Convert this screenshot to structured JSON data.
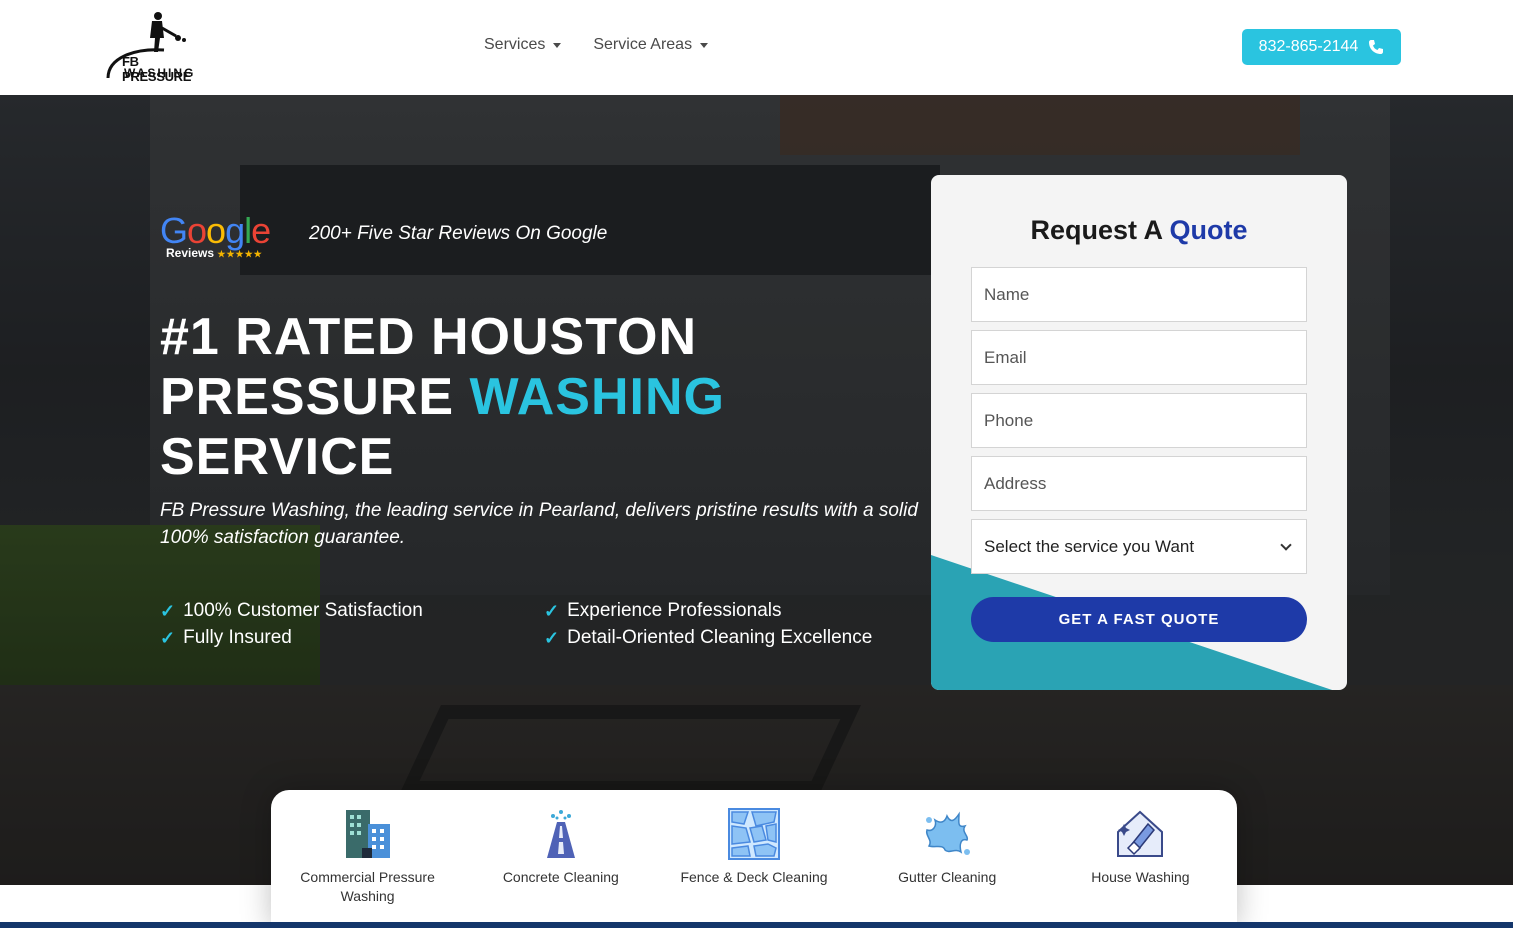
{
  "brand": {
    "line1": "FB PRESSURE",
    "line2": "WASHING"
  },
  "nav": {
    "items": [
      {
        "label": "Services"
      },
      {
        "label": "Service Areas"
      }
    ]
  },
  "header": {
    "phone": "832-865-2144"
  },
  "hero": {
    "google_word": "Google",
    "google_sub": "Reviews",
    "google_stars": "★★★★★",
    "review_text": "200+ Five Star Reviews On Google",
    "headline_line1": "#1 RATED HOUSTON",
    "headline_line2_pre": "PRESSURE ",
    "headline_line2_accent": "WASHING",
    "headline_line3": "SERVICE",
    "subcopy": "FB Pressure Washing, the leading service in Pearland, delivers pristine results with a solid 100% satisfaction guarantee.",
    "features": [
      "100% Customer Satisfaction",
      "Experience Professionals",
      "Fully Insured",
      "Detail-Oriented Cleaning Excellence"
    ]
  },
  "quote": {
    "title_pre": "Request A ",
    "title_accent": "Quote",
    "fields": {
      "name": "Name",
      "email": "Email",
      "phone": "Phone",
      "address": "Address"
    },
    "select_value": "Select the service you Want",
    "button": "GET A FAST QUOTE"
  },
  "services": [
    {
      "label": "Commercial Pressure Washing",
      "icon": "building-icon"
    },
    {
      "label": "Concrete Cleaning",
      "icon": "road-icon"
    },
    {
      "label": "Fence & Deck Cleaning",
      "icon": "stone-tiles-icon"
    },
    {
      "label": "Gutter Cleaning",
      "icon": "splash-icon"
    },
    {
      "label": "House Washing",
      "icon": "house-brush-icon"
    }
  ],
  "colors": {
    "accent": "#2ac4e0",
    "brand_blue": "#1e3aa8",
    "teal": "#2aa3b4"
  }
}
